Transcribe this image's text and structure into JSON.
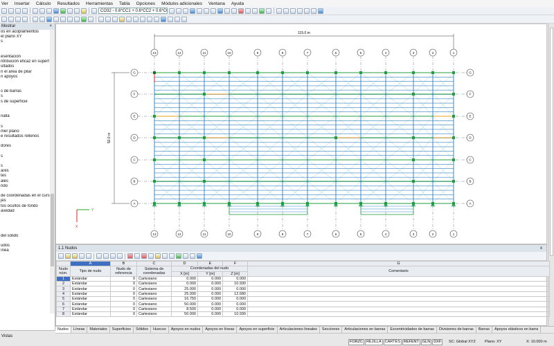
{
  "menu": [
    "Ver",
    "Insertar",
    "Cálculo",
    "Resultados",
    "Herramientas",
    "Tabla",
    "Opciones",
    "Módulos adicionales",
    "Ventana",
    "Ayuda"
  ],
  "toolbar": {
    "load_combo": "CO32 - 0.6*CC1 + 0.6*CC2 + 0.6*CC7"
  },
  "left_panel": {
    "title": "Mostrar",
    "items": [
      "os en acoplamientos",
      "el plano XY",
      "s",
      "",
      "",
      "esentación",
      "ntribución eficaz en superf",
      "ultados",
      "n el área de pilar",
      "n apoyos",
      "",
      "",
      "s de barras",
      "s",
      "s de superficie",
      "",
      "",
      "nalla",
      "",
      "s",
      "mer plano",
      "e resultados rellenos",
      "",
      "dores",
      "",
      "s",
      "",
      "s",
      "ares",
      "tes",
      "ales",
      "ndo",
      "",
      "de coordenadas en el curs",
      "jes",
      "tos ocultos de fondo",
      "avedad",
      "",
      "",
      "",
      "",
      "del sólido",
      "",
      "udos",
      "ínea"
    ],
    "bottom_tab": "Vistas"
  },
  "viewport": {
    "dim_width": "115.0 m",
    "dim_height": "50.0 m",
    "axis_labels": [
      "13",
      "12",
      "11",
      "10",
      "9",
      "8",
      "7",
      "6",
      "5",
      "4",
      "3",
      "2",
      "1"
    ],
    "row_labels": [
      "G",
      "F",
      "E",
      "D",
      "C",
      "B",
      "A"
    ],
    "axis_y": "Y",
    "axis_x": "X"
  },
  "table": {
    "title": "1.1 Nudos",
    "close": "x",
    "letters": [
      "A",
      "B",
      "C",
      "D",
      "E",
      "F",
      "G"
    ],
    "header_num": "Nudo núm.",
    "headers": {
      "A": "Tipo de nudo",
      "B": "Nudo de referencia",
      "C": "Sistema de coordenadas",
      "DEF": "Coordenadas del nudo",
      "D": "X [m]",
      "E": "Y [m]",
      "F": "Z [m]",
      "G": "Comentario"
    },
    "rows": [
      {
        "n": "1",
        "tipo": "Estándar",
        "ref": "0",
        "sis": "Cartesiano",
        "x": "0.000",
        "y": "0.000",
        "z": "0.000"
      },
      {
        "n": "2",
        "tipo": "Estándar",
        "ref": "0",
        "sis": "Cartesiano",
        "x": "0.000",
        "y": "0.000",
        "z": "10.930"
      },
      {
        "n": "3",
        "tipo": "Estándar",
        "ref": "0",
        "sis": "Cartesiano",
        "x": "25.000",
        "y": "0.000",
        "z": "0.000"
      },
      {
        "n": "4",
        "tipo": "Estándar",
        "ref": "0",
        "sis": "Cartesiano",
        "x": "25.000",
        "y": "0.000",
        "z": "12.680"
      },
      {
        "n": "5",
        "tipo": "Estándar",
        "ref": "0",
        "sis": "Cartesiano",
        "x": "16.750",
        "y": "0.000",
        "z": "0.000"
      },
      {
        "n": "6",
        "tipo": "Estándar",
        "ref": "0",
        "sis": "Cartesiano",
        "x": "50.000",
        "y": "0.000",
        "z": "0.000"
      },
      {
        "n": "7",
        "tipo": "Estándar",
        "ref": "0",
        "sis": "Cartesiano",
        "x": "8.500",
        "y": "0.000",
        "z": "0.000"
      },
      {
        "n": "8",
        "tipo": "Estándar",
        "ref": "0",
        "sis": "Cartesiano",
        "x": "50.000",
        "y": "0.000",
        "z": "10.930"
      }
    ]
  },
  "tabs": [
    "Nudos",
    "Líneas",
    "Materiales",
    "Superficies",
    "Sólidos",
    "Huecos",
    "Apoyos en nudos",
    "Apoyos en líneas",
    "Apoyos en superficie",
    "Articulaciones lineales",
    "Secciones",
    "Articulaciones en barras",
    "Excentricidades de barras",
    "Divisiones de barras",
    "Barras",
    "Apoyos elásticos en barra"
  ],
  "status": {
    "toggles": [
      "FORZC",
      "REJILLA",
      "CARTES",
      "REFENT",
      "GLN",
      "DXF"
    ],
    "sc": "SC: Global XYZ",
    "plane": "Plano: XY",
    "coord": "X: 10.000 m"
  },
  "colors": {
    "purlin": "#2c7fc0",
    "column": "#1f9e3c",
    "brace": "#67c8c8",
    "beam_orange": "#e8a020",
    "selection": "#3d6fc2"
  }
}
